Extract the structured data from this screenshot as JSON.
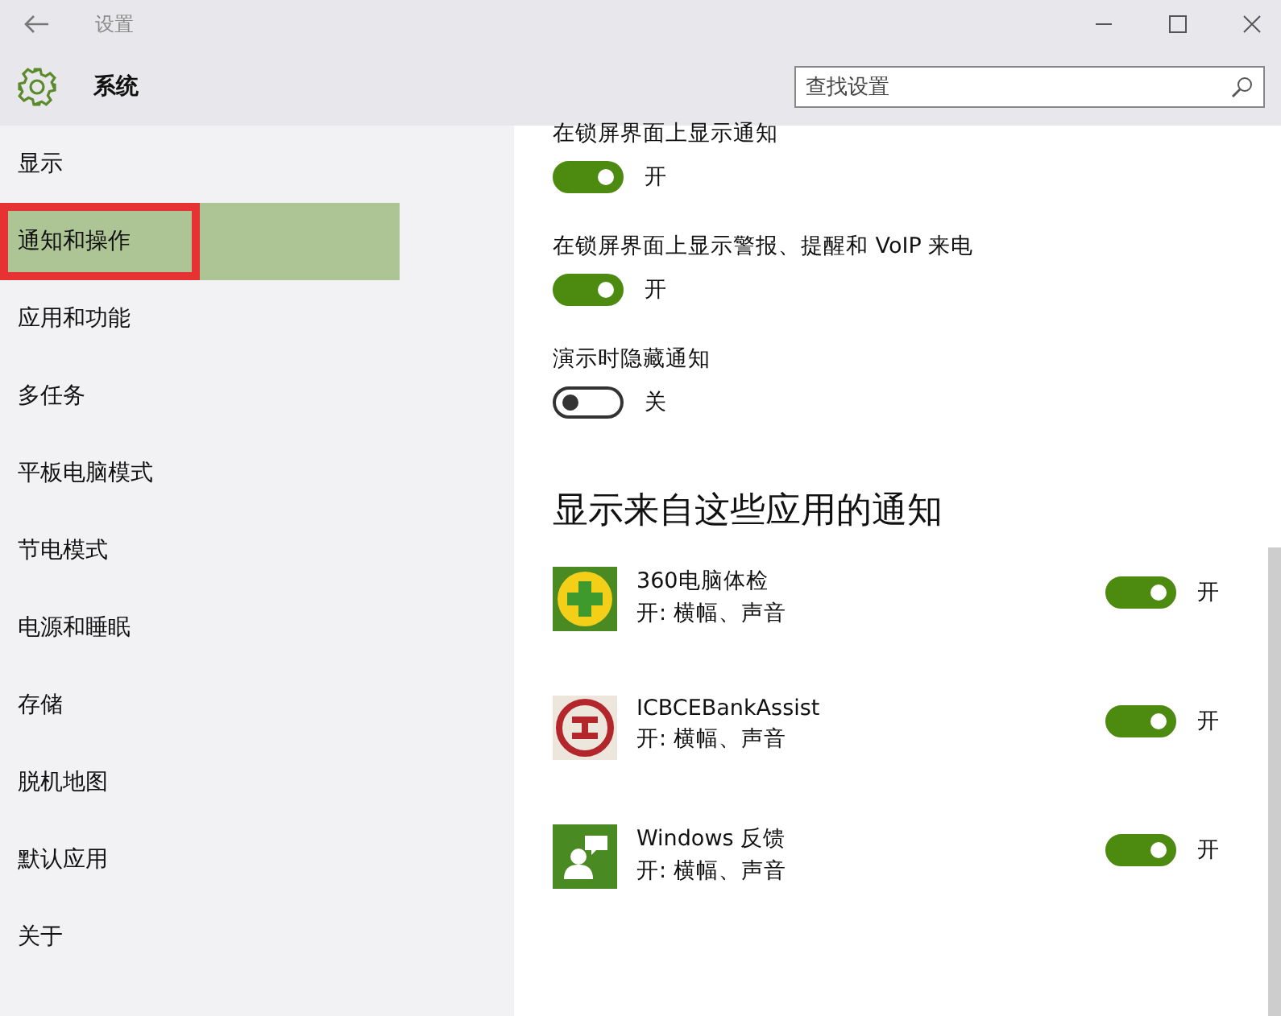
{
  "window": {
    "title": "设置"
  },
  "header": {
    "title": "系统"
  },
  "search": {
    "placeholder": "查找设置"
  },
  "sidebar": {
    "items": [
      {
        "label": "显示",
        "selected": false,
        "annotated": false
      },
      {
        "label": "通知和操作",
        "selected": true,
        "annotated": true
      },
      {
        "label": "应用和功能",
        "selected": false,
        "annotated": false
      },
      {
        "label": "多任务",
        "selected": false,
        "annotated": false
      },
      {
        "label": "平板电脑模式",
        "selected": false,
        "annotated": false
      },
      {
        "label": "节电模式",
        "selected": false,
        "annotated": false
      },
      {
        "label": "电源和睡眠",
        "selected": false,
        "annotated": false
      },
      {
        "label": "存储",
        "selected": false,
        "annotated": false
      },
      {
        "label": "脱机地图",
        "selected": false,
        "annotated": false
      },
      {
        "label": "默认应用",
        "selected": false,
        "annotated": false
      },
      {
        "label": "关于",
        "selected": false,
        "annotated": false
      }
    ]
  },
  "settings": [
    {
      "label": "在锁屏界面上显示通知",
      "on": true,
      "state_label": "开"
    },
    {
      "label": "在锁屏界面上显示警报、提醒和 VoIP 来电",
      "on": true,
      "state_label": "开"
    },
    {
      "label": "演示时隐藏通知",
      "on": false,
      "state_label": "关"
    }
  ],
  "apps_section": {
    "title": "显示来自这些应用的通知",
    "apps": [
      {
        "kind": "cross",
        "name": "360电脑体检",
        "detail": "开: 横幅、声音",
        "on": true,
        "state_label": "开"
      },
      {
        "kind": "bank",
        "name": "ICBCEBankAssist",
        "detail": "开: 横幅、声音",
        "on": true,
        "state_label": "开"
      },
      {
        "kind": "feedback",
        "name": "Windows 反馈",
        "detail": "开: 横幅、声音",
        "on": true,
        "state_label": "开"
      }
    ]
  }
}
